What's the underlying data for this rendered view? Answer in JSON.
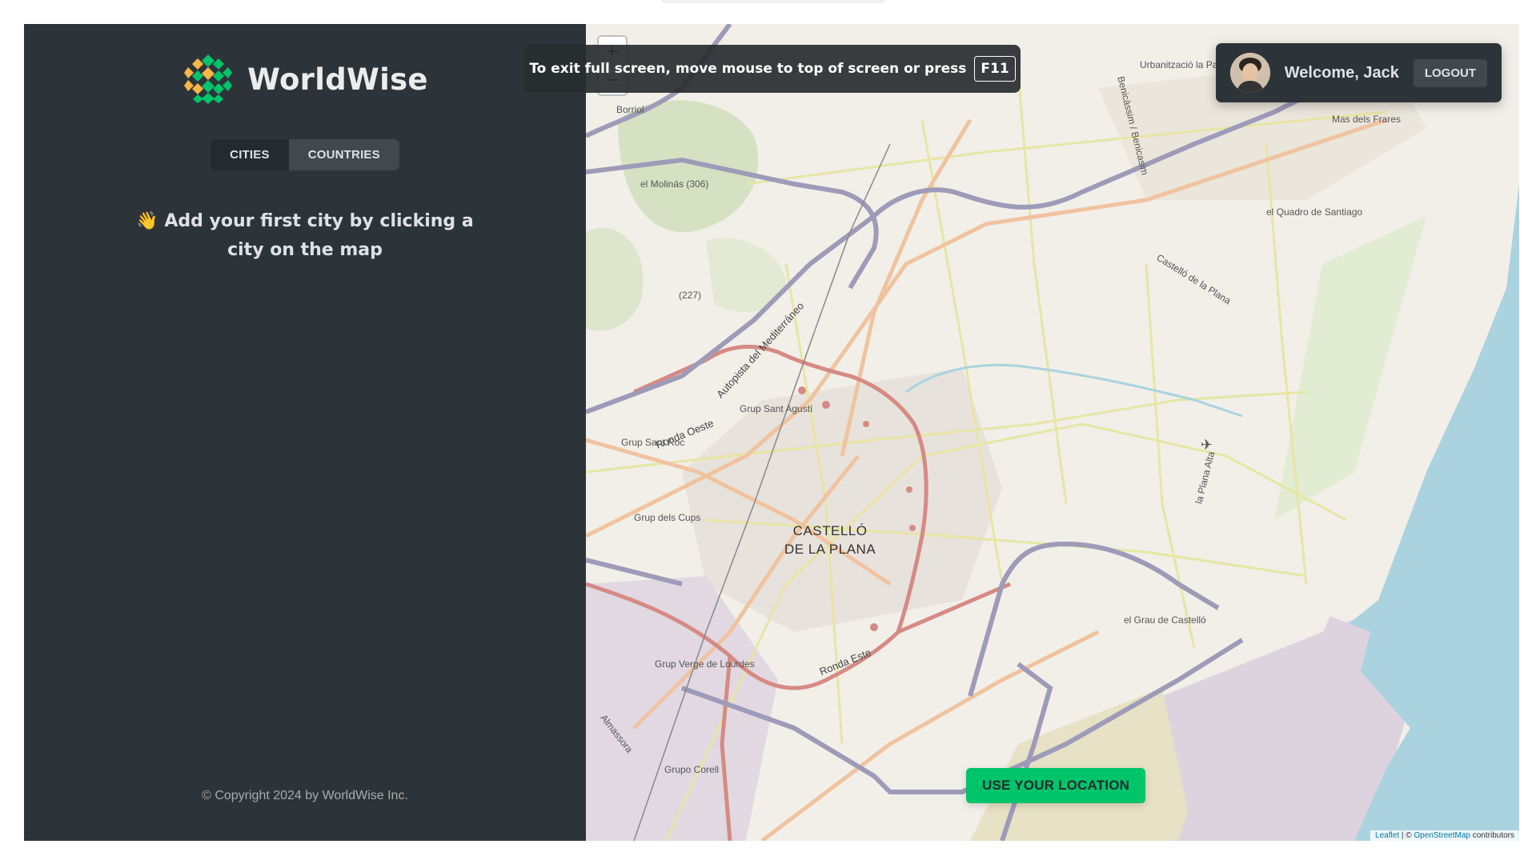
{
  "app": {
    "name": "WorldWise",
    "tabs": [
      {
        "label": "CITIES",
        "active": true
      },
      {
        "label": "COUNTRIES",
        "active": false
      }
    ],
    "empty_message": "👋 Add your first city by clicking a city on the map",
    "footer": "© Copyright 2024 by WorldWise Inc."
  },
  "user": {
    "welcome": "Welcome, Jack",
    "logout_label": "LOGOUT"
  },
  "map": {
    "zoom_in": "+",
    "zoom_out": "−",
    "use_location_label": "USE YOUR LOCATION",
    "attribution": {
      "leaflet": "Leaflet",
      "separator": " | © ",
      "osm": "OpenStreetMap",
      "suffix": " contributors"
    },
    "labels": {
      "city": "CASTELLÓ\nDE LA PLANA",
      "ronda_oeste": "Ronda Oeste",
      "ronda_este": "Ronda Este",
      "autopista": "Autopista del Mediterráneo",
      "grup_sant_agusti": "Grup Sant Agustí",
      "grup_sant_roc": "Grup Sant Roc",
      "grup_dels_cups": "Grup dels Cups",
      "grup_verge": "Grup Verge de Lourdes",
      "grupo_corell": "Grupo Corell",
      "el_grau": "el Grau de Castelló",
      "el_quadro": "el Quadro de Santiago",
      "mas_dels_frares": "Mas dels Frares",
      "urbanitzacio": "Urbanització la Parreta",
      "el_molinas": "el Molinás (306)",
      "hill_227": "(227)",
      "borriol": "Borriol",
      "castello_plana": "Castelló de la Plana",
      "benicassim": "Benicàssim / Benicasim",
      "plana_alta": "la Plana Alta",
      "almassora": "Almassora"
    },
    "colors": {
      "water": "#aad3df",
      "land": "#f2efe9",
      "motorway": "#9e9bb9",
      "primary": "#d68a84",
      "secondary": "#f0c3a0",
      "tertiary": "#e6e6a4"
    }
  },
  "fullscreen": {
    "message": "To exit full screen, move mouse to top of screen or press",
    "key": "F11"
  },
  "theme": {
    "sidebar_bg": "#2d3439",
    "accent_green": "#00c46a"
  }
}
